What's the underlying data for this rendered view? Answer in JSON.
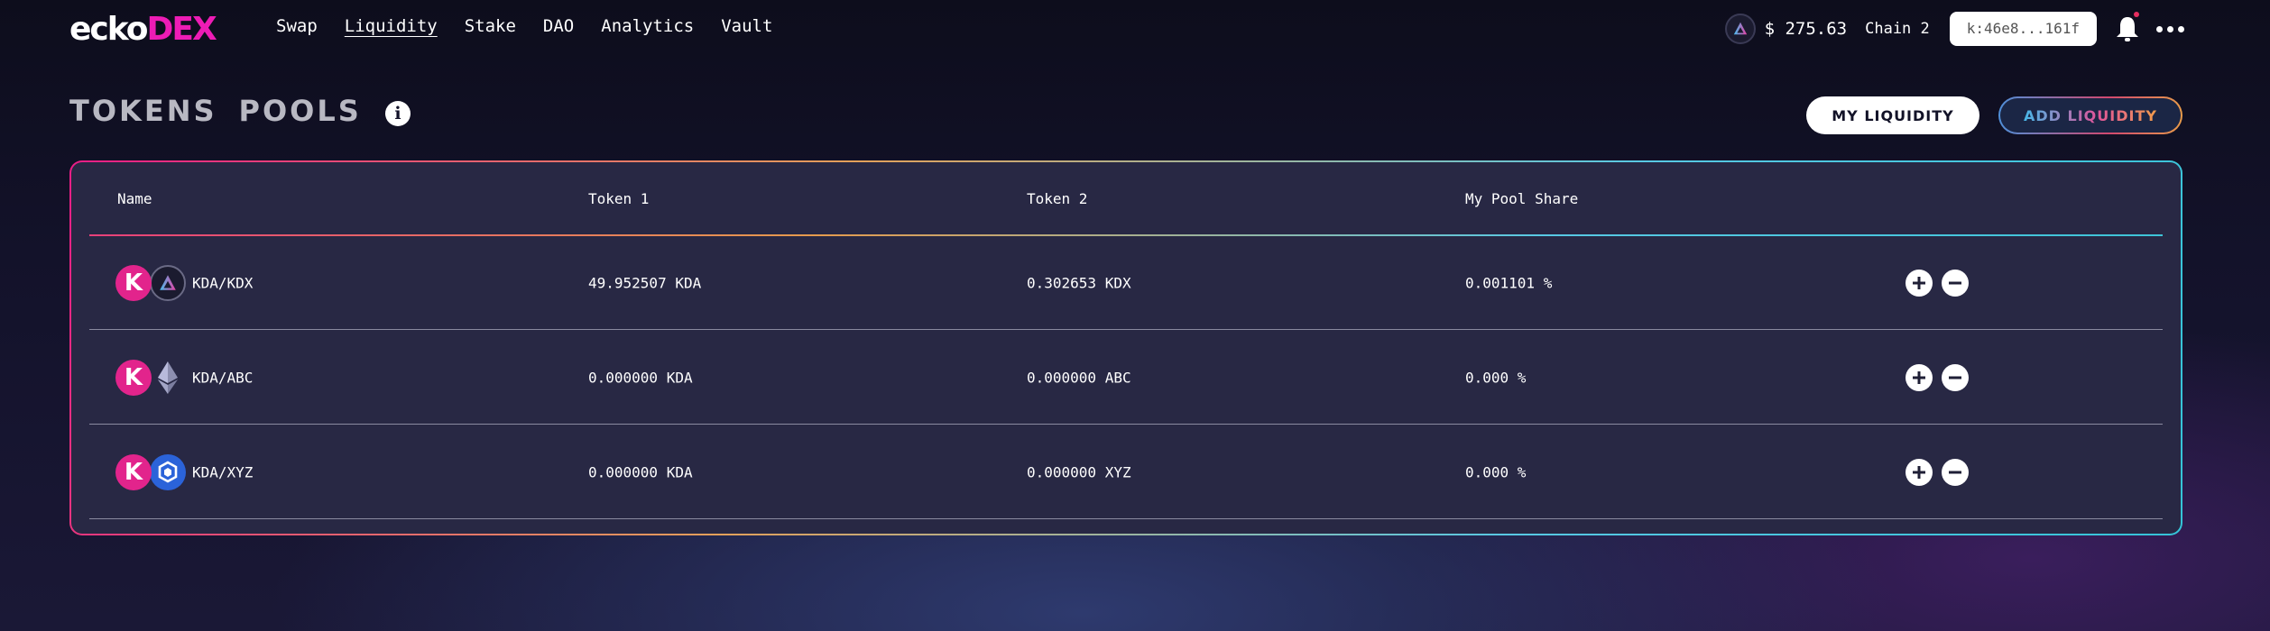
{
  "header": {
    "logo_part1": "ecko",
    "logo_part2": "DEX",
    "nav": [
      "Swap",
      "Liquidity",
      "Stake",
      "DAO",
      "Analytics",
      "Vault"
    ],
    "active_nav": "Liquidity",
    "price": "$ 275.63",
    "chain": "Chain 2",
    "account": "k:46e8...161f"
  },
  "page": {
    "title_word1": "TOKENS",
    "title_word2": "POOLS",
    "my_liquidity_label": "MY LIQUIDITY",
    "add_liquidity_label": "ADD LIQUIDITY"
  },
  "table": {
    "columns": [
      "Name",
      "Token 1",
      "Token 2",
      "My Pool Share"
    ],
    "rows": [
      {
        "name": "KDA/KDX",
        "token1": "49.952507 KDA",
        "token2": "0.302653 KDX",
        "share": "0.001101 %",
        "icon2": "kdx-token-icon"
      },
      {
        "name": "KDA/ABC",
        "token1": "0.000000 KDA",
        "token2": "0.000000 ABC",
        "share": "0.000 %",
        "icon2": "ethereum-token-icon"
      },
      {
        "name": "KDA/XYZ",
        "token1": "0.000000 KDA",
        "token2": "0.000000 XYZ",
        "share": "0.000 %",
        "icon2": "hex-token-icon"
      }
    ]
  },
  "colors": {
    "brand_pink": "#ed1cb5",
    "kda_pink": "#e2248c",
    "panel_bg": "#282844"
  }
}
